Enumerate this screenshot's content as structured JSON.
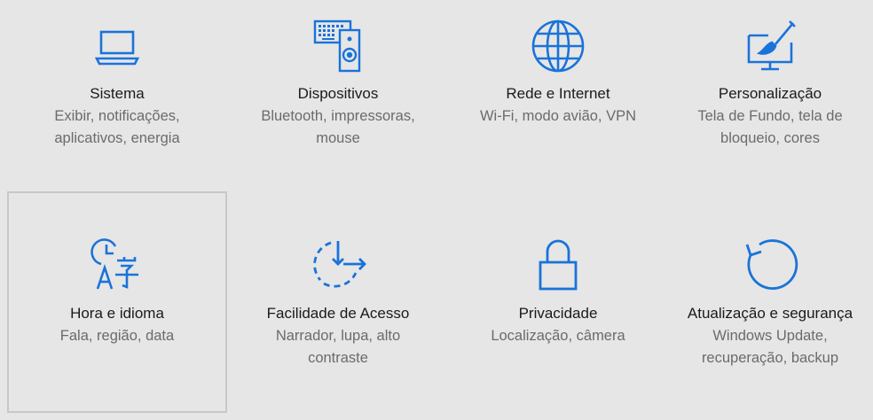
{
  "accent": "#1a73d9",
  "tiles": [
    {
      "id": "sistema",
      "icon": "laptop-icon",
      "title": "Sistema",
      "desc1": "Exibir, notificações,",
      "desc2": "aplicativos, energia"
    },
    {
      "id": "dispositivos",
      "icon": "devices-icon",
      "title": "Dispositivos",
      "desc1": "Bluetooth, impressoras,",
      "desc2": "mouse"
    },
    {
      "id": "rede",
      "icon": "globe-icon",
      "title": "Rede e Internet",
      "desc1": "Wi-Fi, modo avião, VPN",
      "desc2": ""
    },
    {
      "id": "personalizacao",
      "icon": "paintbrush-monitor-icon",
      "title": "Personalização",
      "desc1": "Tela de Fundo, tela de",
      "desc2": "bloqueio, cores"
    },
    {
      "id": "hora",
      "icon": "time-language-icon",
      "title": "Hora e idioma",
      "desc1": "Fala, região, data",
      "desc2": ""
    },
    {
      "id": "facilidade",
      "icon": "ease-of-access-icon",
      "title": "Facilidade de Acesso",
      "desc1": "Narrador, lupa, alto",
      "desc2": "contraste"
    },
    {
      "id": "privacidade",
      "icon": "lock-icon",
      "title": "Privacidade",
      "desc1": "Localização, câmera",
      "desc2": ""
    },
    {
      "id": "atualizacao",
      "icon": "update-icon",
      "title": "Atualização e segurança",
      "desc1": "Windows Update,",
      "desc2": "recuperação, backup"
    }
  ]
}
